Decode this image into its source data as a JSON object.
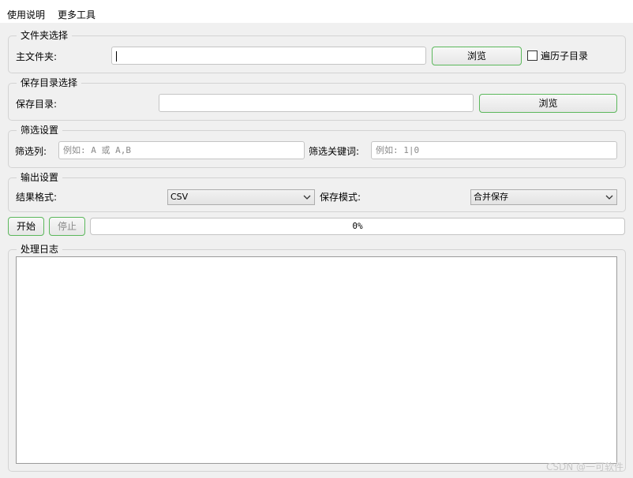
{
  "menu": {
    "usage": "使用说明",
    "more_tools": "更多工具"
  },
  "folder_group": {
    "title": "文件夹选择",
    "main_folder_label": "主文件夹:",
    "main_folder_value": "",
    "browse_label": "浏览",
    "traverse_label": "遍历子目录",
    "traverse_checked": false
  },
  "save_group": {
    "title": "保存目录选择",
    "save_dir_label": "保存目录:",
    "save_dir_value": "",
    "browse_label": "浏览"
  },
  "filter_group": {
    "title": "筛选设置",
    "filter_col_label": "筛选列:",
    "filter_col_placeholder": "例如: A 或 A,B",
    "filter_keyword_label": "筛选关键词:",
    "filter_keyword_placeholder": "例如: 1|0"
  },
  "output_group": {
    "title": "输出设置",
    "format_label": "结果格式:",
    "format_value": "CSV",
    "save_mode_label": "保存模式:",
    "save_mode_value": "合并保存"
  },
  "controls": {
    "start_label": "开始",
    "stop_label": "停止",
    "progress_text": "0%",
    "progress_value": 0
  },
  "log_group": {
    "title": "处理日志",
    "content": ""
  },
  "watermark": "CSDN @一可软件",
  "colors": {
    "button_border": "#5cb85c",
    "background": "#f0f0f0"
  }
}
